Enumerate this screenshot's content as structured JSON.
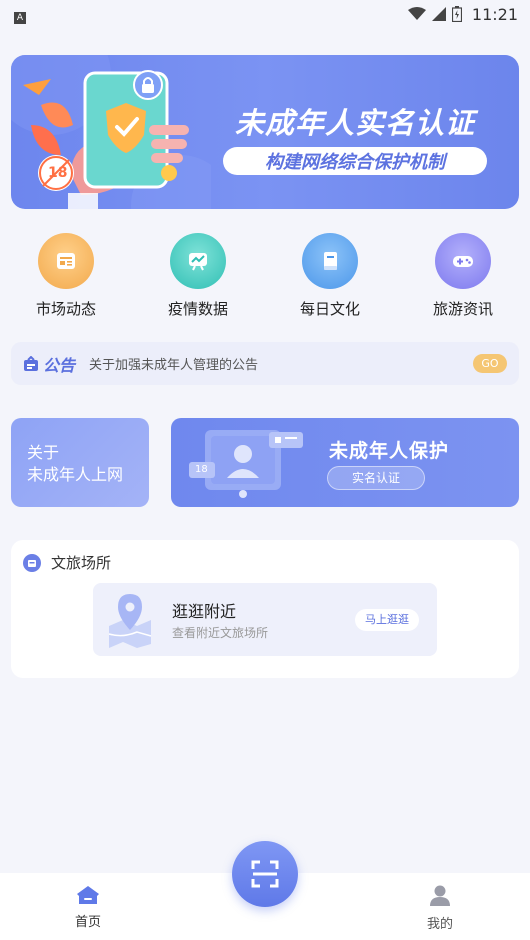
{
  "status_bar": {
    "left_glyph": "A",
    "time": "11:21",
    "icons": [
      "wifi-icon",
      "signal-icon",
      "battery-icon"
    ]
  },
  "banner": {
    "title": "未成年人实名认证",
    "subtitle": "构建网络综合保护机制",
    "age_badge": "18"
  },
  "menu": {
    "items": [
      {
        "label": "市场动态",
        "icon": "news-icon",
        "color": "#f5b05a"
      },
      {
        "label": "疫情数据",
        "icon": "chart-board-icon",
        "color": "#3ec6be"
      },
      {
        "label": "每日文化",
        "icon": "book-icon",
        "color": "#5aa2ee"
      },
      {
        "label": "旅游资讯",
        "icon": "gamepad-icon",
        "color": "#8a86f0"
      }
    ]
  },
  "notice": {
    "tag": "公告",
    "text": "关于加强未成年人管理的公告",
    "button": "GO"
  },
  "promo": {
    "left_line1": "关于",
    "left_line2": "未成年人上网",
    "right_title": "未成年人保护",
    "right_button": "实名认证",
    "right_badge": "18"
  },
  "venue": {
    "title": "文旅场所",
    "card_title": "逛逛附近",
    "card_subtitle": "查看附近文旅场所",
    "card_button": "马上逛逛"
  },
  "tabbar": {
    "home_label": "首页",
    "mine_label": "我的"
  },
  "colors": {
    "accent": "#6b82ec",
    "background": "#f4f5fb",
    "go_button": "#f5c673"
  }
}
